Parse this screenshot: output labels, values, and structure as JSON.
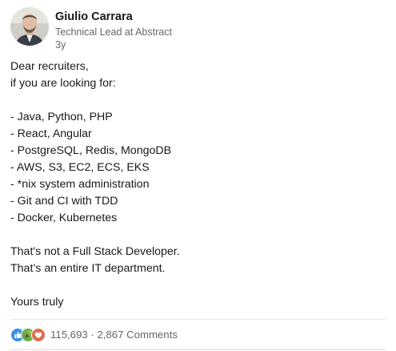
{
  "author": {
    "name": "Giulio Carrara",
    "headline": "Technical Lead at Abstract",
    "time": "3y"
  },
  "post": {
    "lines": [
      "Dear recruiters,",
      "if you are looking for:",
      "",
      "- Java, Python, PHP",
      "- React, Angular",
      "- PostgreSQL, Redis, MongoDB",
      "- AWS, S3, EC2, ECS, EKS",
      "- *nix system administration",
      "- Git and CI with TDD",
      "- Docker, Kubernetes",
      "",
      "That's not a Full Stack Developer.",
      "That’s an entire IT department.",
      "",
      "Yours truly"
    ]
  },
  "social": {
    "reactions": [
      "like-icon",
      "celebrate-icon",
      "love-icon"
    ],
    "reaction_count": "115,693",
    "separator": " · ",
    "comments": "2,867 Comments"
  },
  "colors": {
    "like": "#378fe9",
    "celebrate": "#44712e",
    "love": "#df704d",
    "muted_text": "#666666",
    "text": "#191919"
  }
}
